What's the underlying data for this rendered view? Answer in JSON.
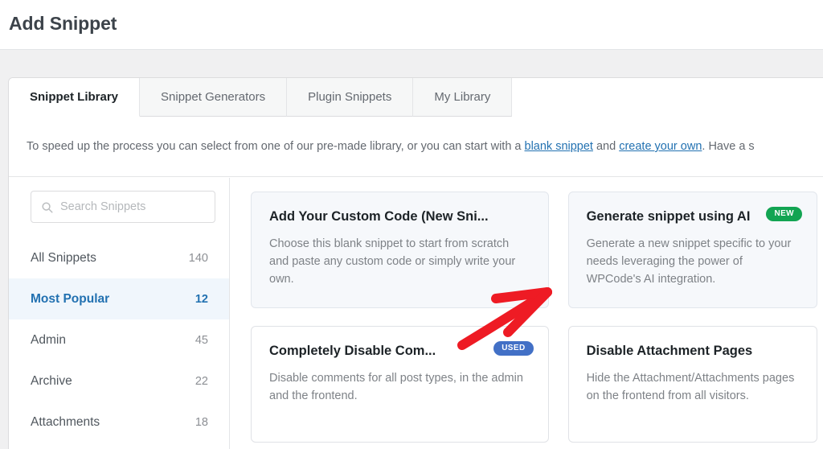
{
  "header": {
    "title": "Add Snippet"
  },
  "tabs": [
    {
      "label": "Snippet Library",
      "active": true
    },
    {
      "label": "Snippet Generators",
      "active": false
    },
    {
      "label": "Plugin Snippets",
      "active": false
    },
    {
      "label": "My Library",
      "active": false
    }
  ],
  "intro": {
    "before_link1": "To speed up the process you can select from one of our pre-made library, or you can start with a ",
    "link1": "blank snippet",
    "between_links": " and ",
    "link2": "create your own",
    "after_link2": ". Have a s"
  },
  "search": {
    "placeholder": "Search Snippets",
    "value": "",
    "icon": "search-icon"
  },
  "sidebar": {
    "items": [
      {
        "label": "All Snippets",
        "count": "140",
        "active": false
      },
      {
        "label": "Most Popular",
        "count": "12",
        "active": true
      },
      {
        "label": "Admin",
        "count": "45",
        "active": false
      },
      {
        "label": "Archive",
        "count": "22",
        "active": false
      },
      {
        "label": "Attachments",
        "count": "18",
        "active": false
      }
    ]
  },
  "cards": [
    {
      "title": "Add Your Custom Code (New Sni...",
      "description": "Choose this blank snippet to start from scratch and paste any custom code or simply write your own.",
      "badge": "",
      "badge_type": "",
      "tinted": true
    },
    {
      "title": "Generate snippet using AI",
      "description": "Generate a new snippet specific to your needs leveraging the power of WPCode's AI integration.",
      "badge": "NEW",
      "badge_type": "new",
      "tinted": true
    },
    {
      "title": "Completely Disable Com...",
      "description": "Disable comments for all post types, in the admin and the frontend.",
      "badge": "USED",
      "badge_type": "used",
      "tinted": false
    },
    {
      "title": "Disable Attachment Pages",
      "description": "Hide the Attachment/Attachments pages on the frontend from all visitors.",
      "badge": "",
      "badge_type": "",
      "tinted": false
    }
  ],
  "annotation": {
    "type": "arrow",
    "color": "#ee1b24",
    "points_to": "Generate snippet using AI"
  },
  "colors": {
    "accent_blue": "#2271b1",
    "badge_new_green": "#12a452",
    "badge_used_blue": "#4270c6",
    "annotation_red": "#ee1b24",
    "page_background": "#f0f0f1"
  }
}
